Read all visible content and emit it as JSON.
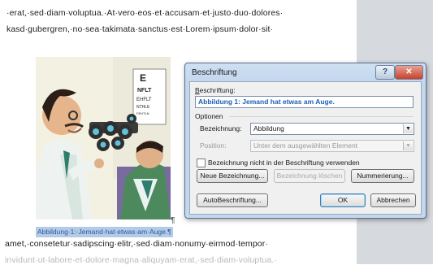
{
  "document": {
    "line1": "·erat,·sed·diam·voluptua.·At·vero·eos·et·accusam·et·justo·duo·dolores·",
    "line2": "kasd·gubergren,·no·sea·takimata·sanctus·est·Lorem·ipsum·dolor·sit·",
    "pilcrow": "¶",
    "caption_selected": "Abbildung·1:·Jemand·hat·etwas·am·Auge.¶",
    "line3": "amet,·consetetur·sadipscing·elitr,·sed·diam·nonumy·eirmod·tempor·",
    "line4": "invidunt·ut·labore·et·dolore·magna·aliquyam·erat,·sed·diam·voluptua.·"
  },
  "dialog": {
    "title": "Beschriftung",
    "help_label": "?",
    "close_label": "✕",
    "caption_label_rest": "eschriftung:",
    "caption_label_access": "B",
    "caption_value": "Abbildung 1: Jemand hat etwas am Auge.",
    "options_label": "Optionen",
    "label_field_label": "Bezeichnung:",
    "label_value": "Abbildung",
    "position_label": "Position:",
    "position_value": "Unter dem ausgewählten Element",
    "exclude_checkbox_label": "Bezeichnung nicht in der Beschriftung verwenden",
    "exclude_checked": false,
    "new_label_button": "Neue Bezeichnung...",
    "delete_label_button": "Bezeichnung löschen",
    "numbering_button": "Nummerierung...",
    "autocaption_button": "AutoBeschriftung...",
    "ok_button": "OK",
    "cancel_button": "Abbrechen"
  },
  "colors": {
    "dialog_frame": "#c3d7ee",
    "close_button": "#c7412b",
    "selection": "#b4cbe6",
    "caption_text": "#1f5fb8",
    "gutter": "#d6d9de"
  }
}
